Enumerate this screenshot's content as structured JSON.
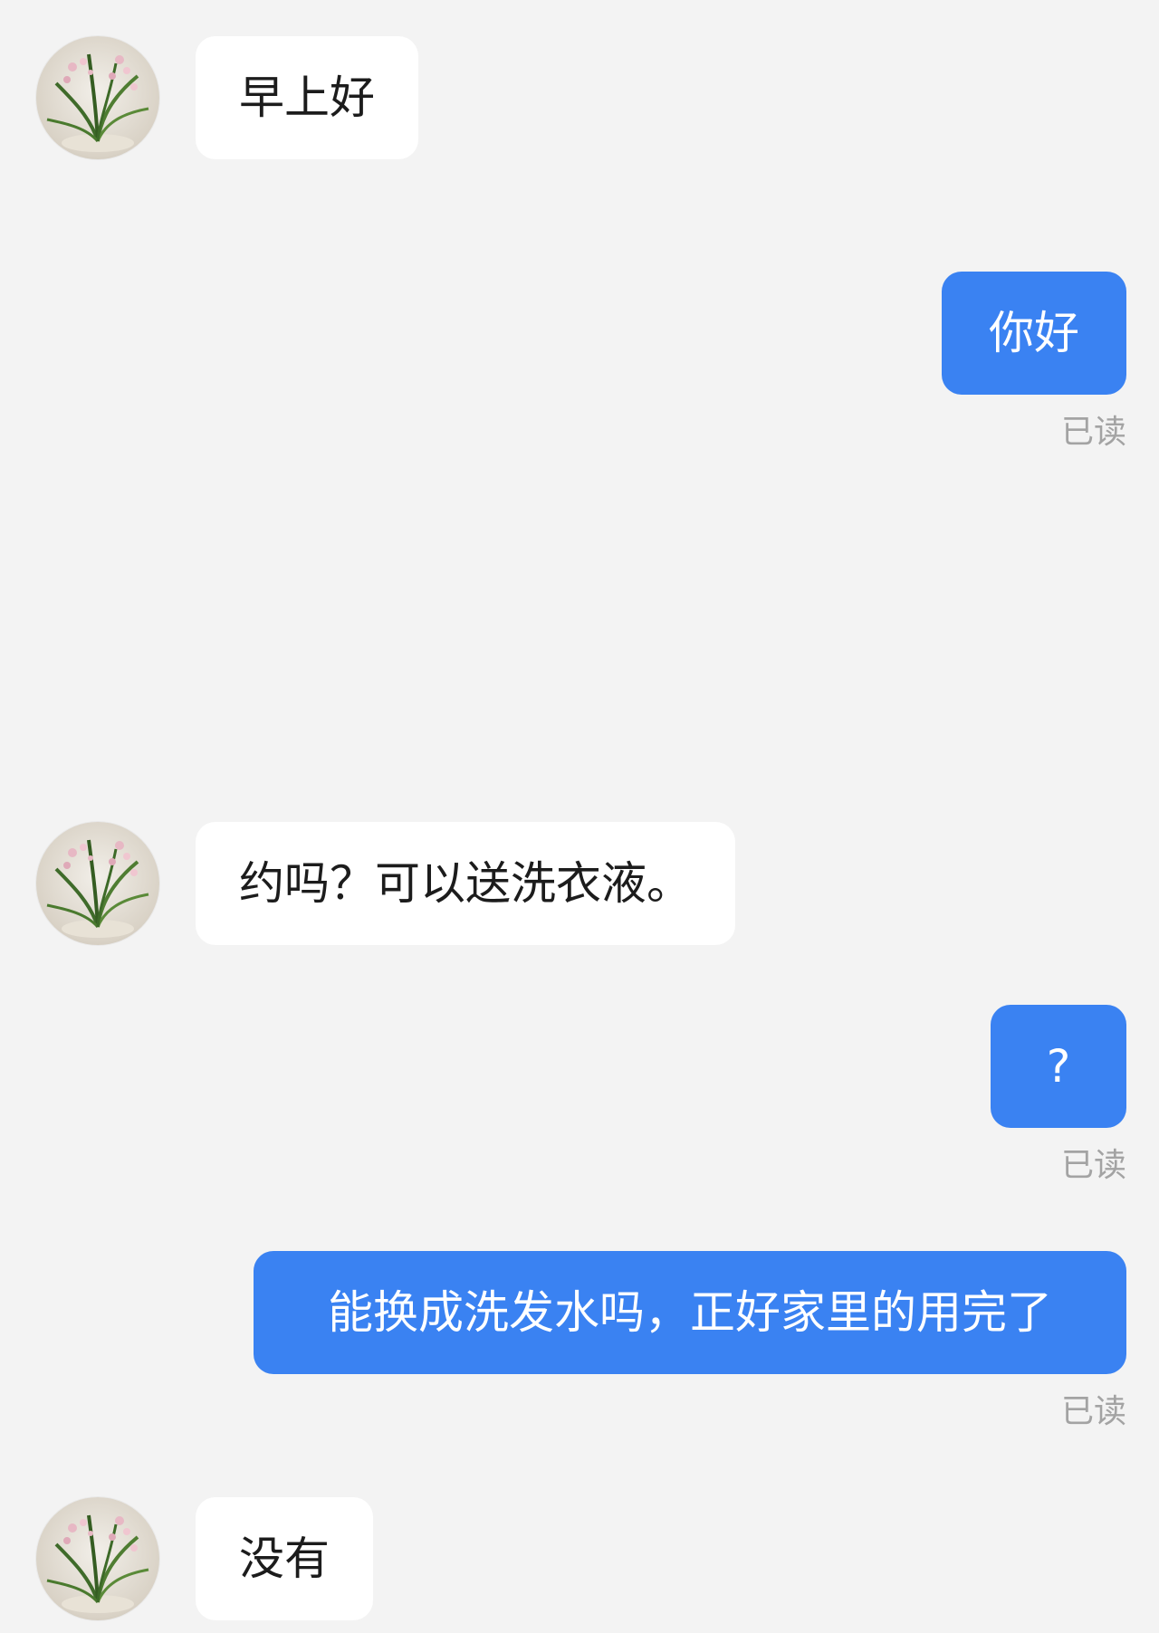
{
  "chat": {
    "messages": [
      {
        "direction": "incoming",
        "text": "早上好"
      },
      {
        "direction": "outgoing",
        "text": "你好",
        "status": "已读"
      },
      {
        "direction": "incoming",
        "text": "约吗？可以送洗衣液。"
      },
      {
        "direction": "outgoing",
        "text": "?",
        "status": "已读"
      },
      {
        "direction": "outgoing",
        "text": "能换成洗发水吗，正好家里的用完了",
        "status": "已读"
      },
      {
        "direction": "incoming",
        "text": "没有"
      }
    ]
  },
  "colors": {
    "background": "#f3f3f3",
    "incoming_bubble": "#ffffff",
    "outgoing_bubble": "#3a82f2",
    "read_receipt": "#a3a3a3"
  },
  "icons": {
    "avatar": "orchid-plant-avatar"
  }
}
